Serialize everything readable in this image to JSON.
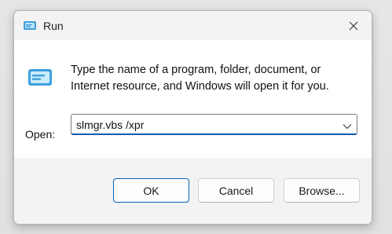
{
  "window": {
    "title": "Run",
    "icon": "run-icon",
    "close_icon": "close-icon"
  },
  "content": {
    "description_line1": "Type the name of a program, folder, document, or",
    "description_line2": "Internet resource, and Windows will open it for you.",
    "open_label": "Open:",
    "open_value": "slmgr.vbs /xpr",
    "dropdown_icon": "chevron-down-icon"
  },
  "buttons": {
    "ok": "OK",
    "cancel": "Cancel",
    "browse": "Browse..."
  },
  "colors": {
    "accent": "#005fb8",
    "icon_blue": "#3fa0dc",
    "dialog_bg": "#f3f3f3",
    "content_bg": "#ffffff"
  }
}
